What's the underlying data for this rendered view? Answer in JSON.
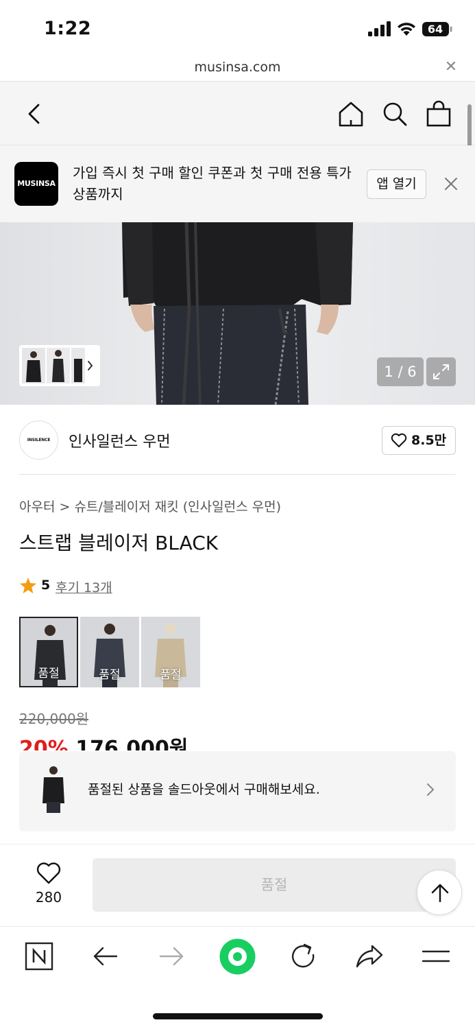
{
  "status_bar": {
    "time": "1:22",
    "battery": "64",
    "url": "musinsa.com"
  },
  "nav": {
    "icons": [
      "back-icon",
      "home-icon",
      "search-icon",
      "shopping-bag-icon"
    ]
  },
  "app_banner": {
    "logo_text": "MUSINSA",
    "message": "가입 즉시 첫 구매 할인 쿠폰과 첫 구매 전용 특가 상품까지",
    "open_app_label": "앱 열기"
  },
  "gallery": {
    "counter": "1 / 6"
  },
  "brand": {
    "logo_text": "INSILENCE",
    "name": "인사일런스 우먼",
    "likes": "8.5만"
  },
  "product": {
    "breadcrumb": "아우터 > 슈트/블레이저 재킷 (인사일런스 우먼)",
    "title": "스트랩 블레이저 BLACK",
    "rating": "5",
    "reviews": "후기 13개",
    "swatches": [
      {
        "label": "품절",
        "color": "#2a2b2f"
      },
      {
        "label": "품절",
        "color": "#3a3d4a"
      },
      {
        "label": "품절",
        "color": "#c9b99a"
      }
    ],
    "original_price": "220,000원",
    "discount": "20%",
    "sale_price": "176,000원"
  },
  "soldout_card": {
    "text": "품절된 상품을 솔드아웃에서 구매해보세요."
  },
  "purchase_bar": {
    "wish_count": "280",
    "buy_label": "품절"
  },
  "browser_toolbar": {
    "icons": [
      "naver-n-icon",
      "back-arrow-icon",
      "forward-arrow-icon",
      "green-dot-icon",
      "reload-icon",
      "share-icon",
      "menu-icon"
    ],
    "accent": "#19ce60"
  }
}
